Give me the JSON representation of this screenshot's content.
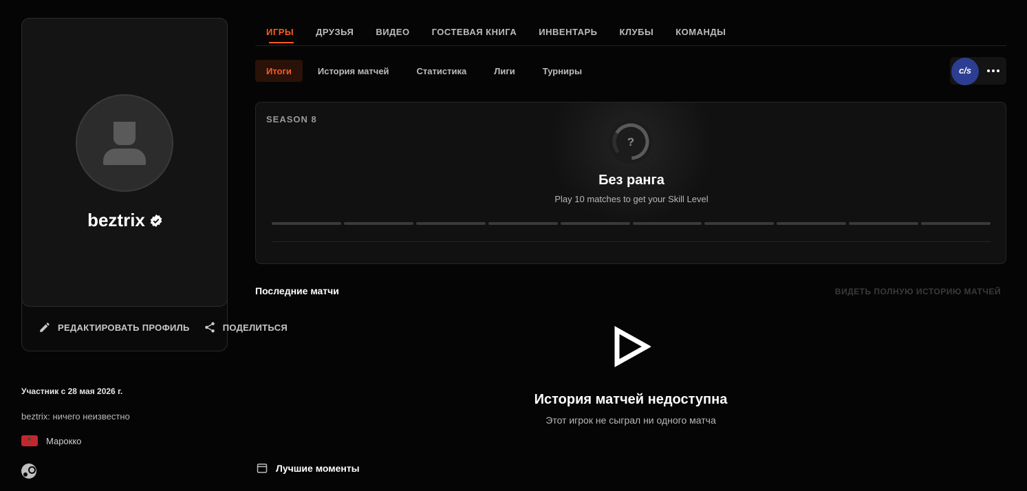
{
  "profile": {
    "username": "beztrix",
    "edit_label": "РЕДАКТИРОВАТЬ ПРОФИЛЬ",
    "share_label": "ПОДЕЛИТЬСЯ",
    "member_since": "Участник с 28 мая 2026 г.",
    "bio": "beztrix: ничего неизвестно",
    "country": "Марокко"
  },
  "main_tabs": [
    {
      "label": "ИГРЫ",
      "active": true
    },
    {
      "label": "ДРУЗЬЯ"
    },
    {
      "label": "ВИДЕО"
    },
    {
      "label": "ГОСТЕВАЯ КНИГА"
    },
    {
      "label": "ИНВЕНТАРЬ"
    },
    {
      "label": "КЛУБЫ"
    },
    {
      "label": "КОМАНДЫ"
    }
  ],
  "sub_tabs": [
    {
      "label": "Итоги",
      "active": true
    },
    {
      "label": "История матчей"
    },
    {
      "label": "Статистика"
    },
    {
      "label": "Лиги"
    },
    {
      "label": "Турниры"
    }
  ],
  "game": {
    "logo_text": "c/s",
    "icon": "more-icon"
  },
  "rank": {
    "season": "SEASON 8",
    "title": "Без ранга",
    "subtitle": "Play 10 matches to get your Skill Level",
    "rank_icon_symbol": "?",
    "level_segments": 10,
    "filled_segments": 0
  },
  "recent": {
    "title": "Последние матчи",
    "full_history": "ВИДЕТЬ ПОЛНУЮ ИСТОРИЮ МАТЧЕЙ",
    "empty_title": "История матчей недоступна",
    "empty_subtitle": "Этот игрок не сыграл ни одного матча"
  },
  "highlights": {
    "title": "Лучшие моменты"
  },
  "colors": {
    "accent": "#ff5a1f",
    "background": "#050505",
    "panel": "#111111",
    "cs_badge": "#2b3e91"
  }
}
